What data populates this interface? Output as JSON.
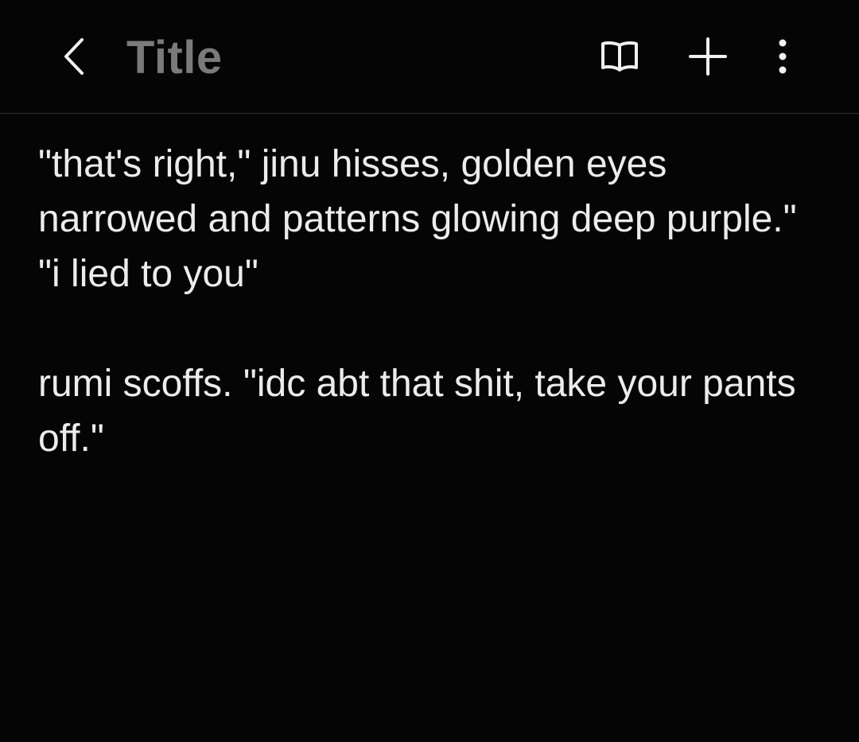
{
  "header": {
    "title_placeholder": "Title",
    "icons": {
      "back": "chevron-left-icon",
      "reader": "open-book-icon",
      "add": "plus-icon",
      "more": "more-vertical-icon"
    }
  },
  "note": {
    "paragraphs": [
      "\"that's right,\" jinu hisses, golden eyes narrowed and patterns glowing deep purple.\" \"i lied to you\"",
      "rumi scoffs. \"idc abt that shit, take your pants off.\""
    ]
  },
  "colors": {
    "background": "#050505",
    "text": "#ececec",
    "title_placeholder": "#7a7a7a",
    "divider": "#2e2e2e"
  }
}
